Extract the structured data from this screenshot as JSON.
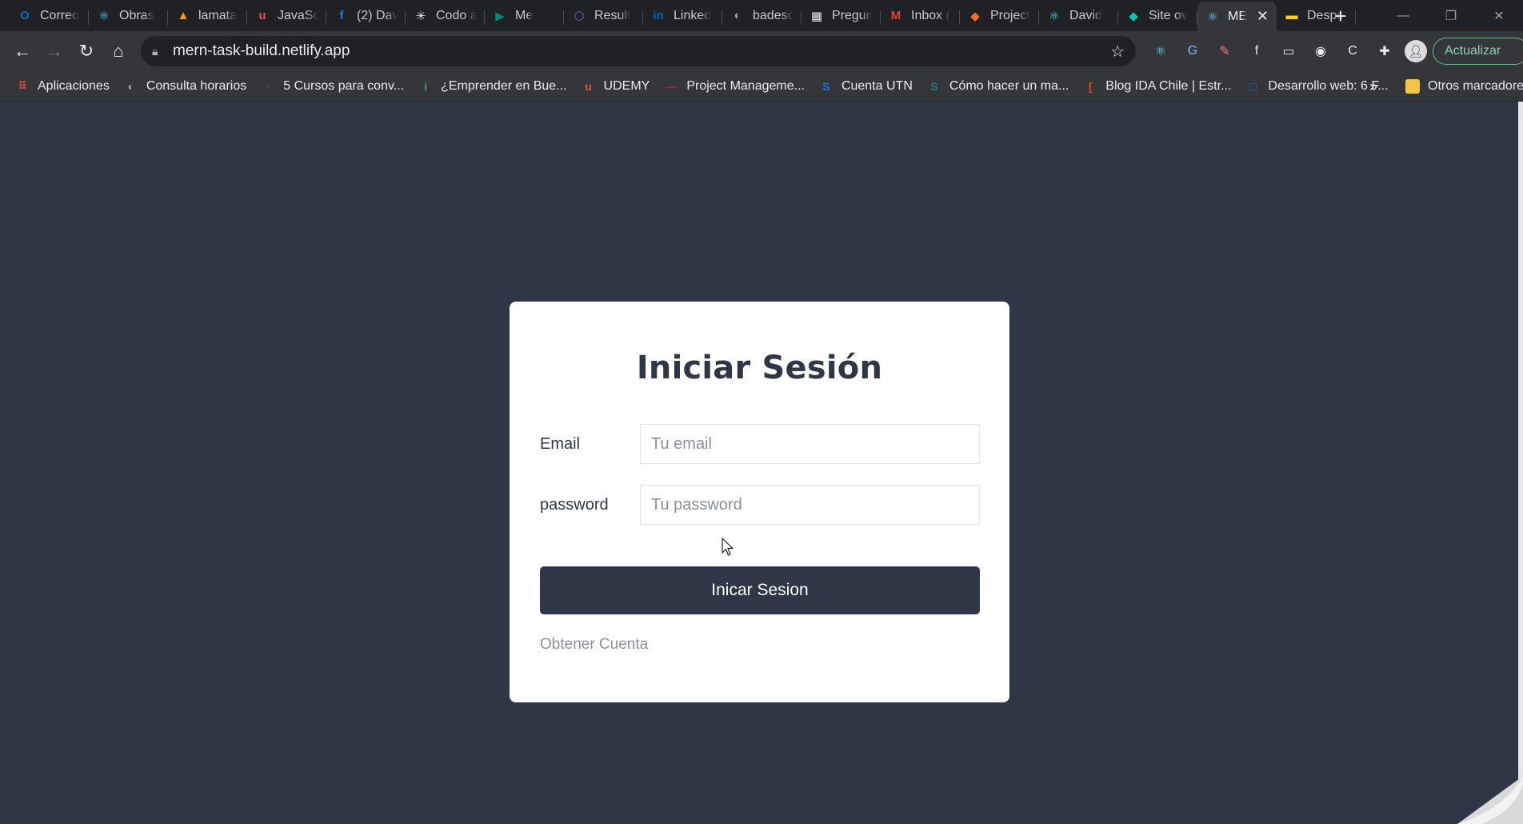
{
  "browser": {
    "tabs": [
      {
        "title": "Correo",
        "icon": "outlook-icon",
        "color": "#0f6cbd",
        "glyph": "O"
      },
      {
        "title": "Obras",
        "icon": "react-icon",
        "color": "#61dafb",
        "glyph": "⚛"
      },
      {
        "title": "lamata",
        "icon": "firebase-icon",
        "color": "#ffa000",
        "glyph": "▲"
      },
      {
        "title": "JavaSc",
        "icon": "udemy-icon",
        "color": "#ec5252",
        "glyph": "u"
      },
      {
        "title": "(2) Dav",
        "icon": "facebook-icon",
        "color": "#1877f2",
        "glyph": "f"
      },
      {
        "title": "Codo a",
        "icon": "codo-icon",
        "color": "#e8eaed",
        "glyph": "✳"
      },
      {
        "title": "Me",
        "icon": "meet-icon",
        "color": "#00897b",
        "glyph": "▶"
      },
      {
        "title": "Result",
        "icon": "result-icon",
        "color": "#7e57c2",
        "glyph": "⬡"
      },
      {
        "title": "Linked",
        "icon": "linkedin-icon",
        "color": "#0a66c2",
        "glyph": "in"
      },
      {
        "title": "badesc",
        "icon": "globe-icon",
        "color": "#9aa0a6",
        "glyph": "◐"
      },
      {
        "title": "Pregun",
        "icon": "sheet-icon",
        "color": "#e8eaed",
        "glyph": "▦"
      },
      {
        "title": "Inbox (",
        "icon": "gmail-icon",
        "color": "#ea4335",
        "glyph": "M"
      },
      {
        "title": "Project",
        "icon": "gitlab-icon",
        "color": "#fc6d26",
        "glyph": "◆"
      },
      {
        "title": "David",
        "icon": "react-icon",
        "color": "#61dafb",
        "glyph": "⚛"
      },
      {
        "title": "Site ov",
        "icon": "netlify-icon",
        "color": "#00c7b7",
        "glyph": "◆"
      },
      {
        "title": "ME",
        "icon": "react-icon",
        "color": "#61dafb",
        "glyph": "⚛",
        "active": true
      },
      {
        "title": "Despe",
        "icon": "despegar-icon",
        "color": "#ffd400",
        "glyph": "▬"
      }
    ],
    "url": "mern-task-build.netlify.app",
    "update_label": "Actualizar",
    "bookmarks": [
      {
        "label": "Aplicaciones",
        "icon": "apps-grid-icon",
        "color": "#ea4335",
        "glyph": "⠿"
      },
      {
        "label": "Consulta horarios",
        "icon": "globe-icon",
        "color": "#9aa0a6",
        "glyph": "◐"
      },
      {
        "label": "5 Cursos para conv...",
        "icon": "bookmark-icon",
        "color": "#3c4043",
        "glyph": "•"
      },
      {
        "label": "¿Emprender en Bue...",
        "icon": "bookmark-i-icon",
        "color": "#34a853",
        "glyph": "i"
      },
      {
        "label": "UDEMY",
        "icon": "udemy-icon",
        "color": "#ec5252",
        "glyph": "u"
      },
      {
        "label": "Project Manageme...",
        "icon": "bookmark-pm-icon",
        "color": "#b3261e",
        "glyph": "—"
      },
      {
        "label": "Cuenta UTN",
        "icon": "utn-icon",
        "color": "#1a73e8",
        "glyph": "S"
      },
      {
        "label": "Cómo hacer un ma...",
        "icon": "scribd-icon",
        "color": "#1e7b85",
        "glyph": "S"
      },
      {
        "label": "Blog IDA Chile | Estr...",
        "icon": "blog-icon",
        "color": "#e8491d",
        "glyph": "["
      },
      {
        "label": "Desarrollo web: 6 F...",
        "icon": "window-icon",
        "color": "#1a73e8",
        "glyph": "□"
      }
    ],
    "bookmarks_more": "»",
    "other_bookmarks": "Otros marcadores"
  },
  "login": {
    "title": "Iniciar Sesión",
    "email_label": "Email",
    "email_placeholder": "Tu email",
    "password_label": "password",
    "password_placeholder": "Tu password",
    "submit_label": "Inicar Sesion",
    "signup_link": "Obtener Cuenta"
  }
}
